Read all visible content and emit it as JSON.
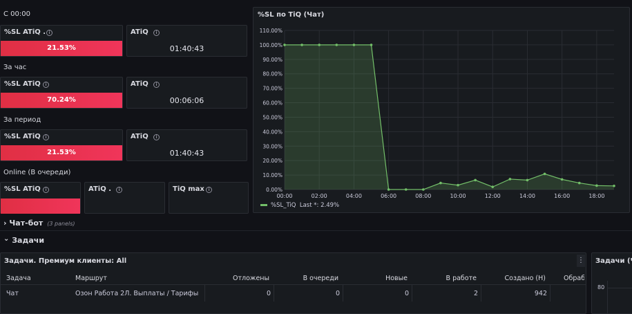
{
  "sections": {
    "since": "С 00:00",
    "hour": "За час",
    "period": "За период",
    "online": "Online (В очереди)"
  },
  "stats": {
    "since_sl_title": "%SL ATiQ .",
    "since_sl_value": "21.53%",
    "since_sl_fraction": 0.2153,
    "since_atiq_title": "ATiQ",
    "since_atiq_value": "01:40:43",
    "hour_sl_title": "%SL ATiQ",
    "hour_sl_value": "70.24%",
    "hour_sl_fraction": 0.7024,
    "hour_atiq_title": "ATiQ",
    "hour_atiq_value": "00:06:06",
    "period_sl_title": "%SL ATiQ",
    "period_sl_value": "21.53%",
    "period_sl_fraction": 0.2153,
    "period_atiq_title": "ATiQ",
    "period_atiq_value": "01:40:43",
    "online_sl_title": "%SL ATiQ",
    "online_atiq_title": "ATiQ .",
    "online_tiq_title": "TiQ max"
  },
  "icons": {
    "info": "info-circle-icon",
    "row_collapsed": "chevron-right-icon",
    "row_expanded": "chevron-down-icon",
    "menu": "vertical-dots-icon",
    "info_glyph": "i",
    "chevron_right_glyph": "›",
    "chevron_down_glyph": "⌄",
    "menu_glyph": "⋮"
  },
  "colors": {
    "bar": "#f0355a",
    "line": "#73bf69",
    "background": "#111217",
    "panel": "#181b1f"
  },
  "rows": {
    "chatbot_title": "Чат-бот",
    "chatbot_sub": "(3 panels)",
    "tasks_title": "Задачи"
  },
  "chart_panel": {
    "title": "%SL по TiQ (Чат)",
    "legend_series": "%SL_TiQ",
    "legend_last": "Last *: 2.49%"
  },
  "chart_data": {
    "type": "area",
    "title": "%SL по TiQ (Чат)",
    "x_ticks": [
      "00:00",
      "02:00",
      "04:00",
      "06:00",
      "08:00",
      "10:00",
      "12:00",
      "14:00",
      "16:00",
      "18:00"
    ],
    "y_ticks": [
      "0.00%",
      "10.00%",
      "20.00%",
      "30.00%",
      "40.00%",
      "50.00%",
      "60.00%",
      "70.00%",
      "80.00%",
      "90.00%",
      "100.00%",
      "110.00%"
    ],
    "ylim": [
      0,
      110
    ],
    "xlim_hours": [
      0,
      19
    ],
    "grid": true,
    "legend": "bottom-left",
    "series": [
      {
        "name": "%SL_TiQ",
        "x_hours": [
          0,
          1,
          2,
          3,
          4,
          5,
          6,
          7,
          8,
          9,
          10,
          11,
          12,
          13,
          14,
          15,
          16,
          17,
          18,
          19
        ],
        "values": [
          100,
          100,
          100,
          100,
          100,
          100,
          0,
          0,
          0,
          4.5,
          3,
          6.5,
          1.8,
          7.2,
          6.5,
          10.8,
          7,
          4.5,
          2.7,
          2.49
        ]
      }
    ]
  },
  "tasks_table": {
    "title": "Задачи. Премиум клиенты: All",
    "headers": [
      "Задача",
      "Маршрут",
      "Отложены",
      "В очереди",
      "Новые",
      "В работе",
      "Создано (Н)",
      "Обраб"
    ],
    "rows": [
      [
        "Чат",
        "Озон Работа 2Л. Выплаты / Тарифы",
        "0",
        "0",
        "0",
        "2",
        "942",
        ""
      ]
    ]
  },
  "side_panel": {
    "title": "Задачи (Чат",
    "y_tick": "80"
  }
}
